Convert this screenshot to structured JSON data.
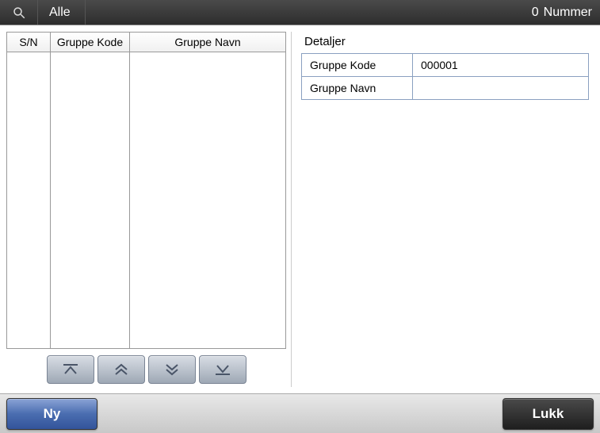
{
  "topbar": {
    "filter_label": "Alle",
    "count": "0",
    "suffix": "Nummer"
  },
  "left_panel": {
    "columns": {
      "sn": "S/N",
      "kode": "Gruppe Kode",
      "navn": "Gruppe Navn"
    },
    "rows": []
  },
  "nav_icons": {
    "first": "first-icon",
    "up": "up-icon",
    "down": "down-icon",
    "last": "last-icon"
  },
  "right_panel": {
    "title": "Detaljer",
    "fields": {
      "kode_label": "Gruppe Kode",
      "kode_value": "000001",
      "navn_label": "Gruppe Navn",
      "navn_value": ""
    }
  },
  "bottombar": {
    "new_label": "Ny",
    "close_label": "Lukk"
  }
}
